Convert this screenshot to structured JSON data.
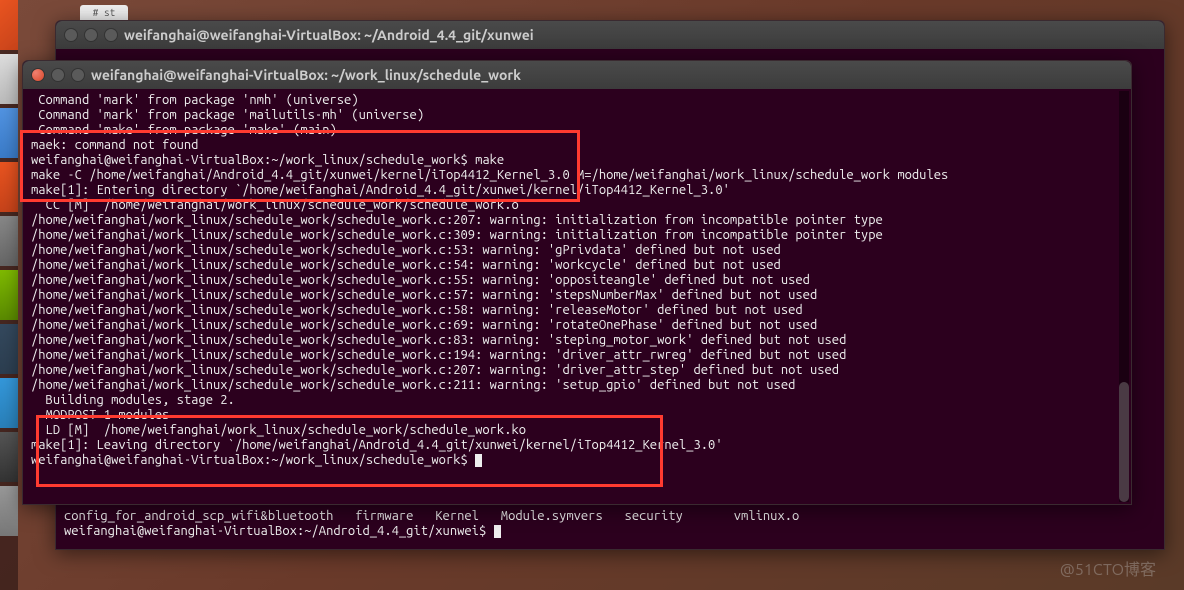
{
  "back_window": {
    "title": "weifanghai@weifanghai-VirtualBox: ~/Android_4.4_git/xunwei",
    "line_frag": "config_for_android_scp_wifi&bluetooth   firmware   Kernel   Module.symvers   security       vmlinux.o",
    "prompt": "weifanghai@weifanghai-VirtualBox:~/Android_4.4_git/xunwei$ "
  },
  "front_window": {
    "title": "weifanghai@weifanghai-VirtualBox: ~/work_linux/schedule_work",
    "lines": {
      "l01": " Command 'mark' from package 'nmh' (universe)",
      "l02": " Command 'mark' from package 'mailutils-mh' (universe)",
      "l03": " Command 'make' from package 'make' (main)",
      "l04": "maek: command not found",
      "l05": "weifanghai@weifanghai-VirtualBox:~/work_linux/schedule_work$ make",
      "l06": "make -C /home/weifanghai/Android_4.4_git/xunwei/kernel/iTop4412_Kernel_3.0 M=/home/weifanghai/work_linux/schedule_work modules",
      "l07": "make[1]: Entering directory `/home/weifanghai/Android_4.4_git/xunwei/kernel/iTop4412_Kernel_3.0'",
      "l08": "  CC [M]  /home/weifanghai/work_linux/schedule_work/schedule_work.o",
      "l09": "/home/weifanghai/work_linux/schedule_work/schedule_work.c:207: warning: initialization from incompatible pointer type",
      "l10": "/home/weifanghai/work_linux/schedule_work/schedule_work.c:309: warning: initialization from incompatible pointer type",
      "l11": "/home/weifanghai/work_linux/schedule_work/schedule_work.c:53: warning: 'gPrivdata' defined but not used",
      "l12": "/home/weifanghai/work_linux/schedule_work/schedule_work.c:54: warning: 'workcycle' defined but not used",
      "l13": "/home/weifanghai/work_linux/schedule_work/schedule_work.c:55: warning: 'oppositeangle' defined but not used",
      "l14": "/home/weifanghai/work_linux/schedule_work/schedule_work.c:57: warning: 'stepsNumberMax' defined but not used",
      "l15": "/home/weifanghai/work_linux/schedule_work/schedule_work.c:58: warning: 'releaseMotor' defined but not used",
      "l16": "/home/weifanghai/work_linux/schedule_work/schedule_work.c:69: warning: 'rotateOnePhase' defined but not used",
      "l17": "/home/weifanghai/work_linux/schedule_work/schedule_work.c:83: warning: 'steping_motor_work' defined but not used",
      "l18": "/home/weifanghai/work_linux/schedule_work/schedule_work.c:194: warning: 'driver_attr_rwreg' defined but not used",
      "l19": "/home/weifanghai/work_linux/schedule_work/schedule_work.c:207: warning: 'driver_attr_step' defined but not used",
      "l20": "/home/weifanghai/work_linux/schedule_work/schedule_work.c:211: warning: 'setup_gpio' defined but not used",
      "l21": "  Building modules, stage 2.",
      "l22": "  MODPOST 1 modules",
      "l23": "  LD [M]  /home/weifanghai/work_linux/schedule_work/schedule_work.ko",
      "l24": "make[1]: Leaving directory `/home/weifanghai/Android_4.4_git/xunwei/kernel/iTop4412_Kernel_3.0'",
      "l25": "weifanghai@weifanghai-VirtualBox:~/work_linux/schedule_work$ "
    }
  },
  "watermark": "@51CTO博客",
  "desktop_icon": "# st"
}
